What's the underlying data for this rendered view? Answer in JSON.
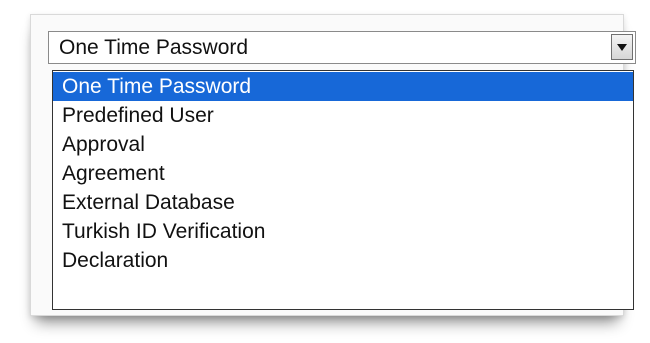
{
  "select": {
    "value": "One Time Password",
    "icon": "chevron-down-icon"
  },
  "options": [
    {
      "label": "One Time Password",
      "selected": true
    },
    {
      "label": "Predefined User",
      "selected": false
    },
    {
      "label": "Approval",
      "selected": false
    },
    {
      "label": "Agreement",
      "selected": false
    },
    {
      "label": "External Database",
      "selected": false
    },
    {
      "label": "Turkish ID Verification",
      "selected": false
    },
    {
      "label": "Declaration",
      "selected": false
    }
  ],
  "colors": {
    "highlight": "#1768d8",
    "highlight_text": "#ffffff",
    "text": "#111111"
  }
}
